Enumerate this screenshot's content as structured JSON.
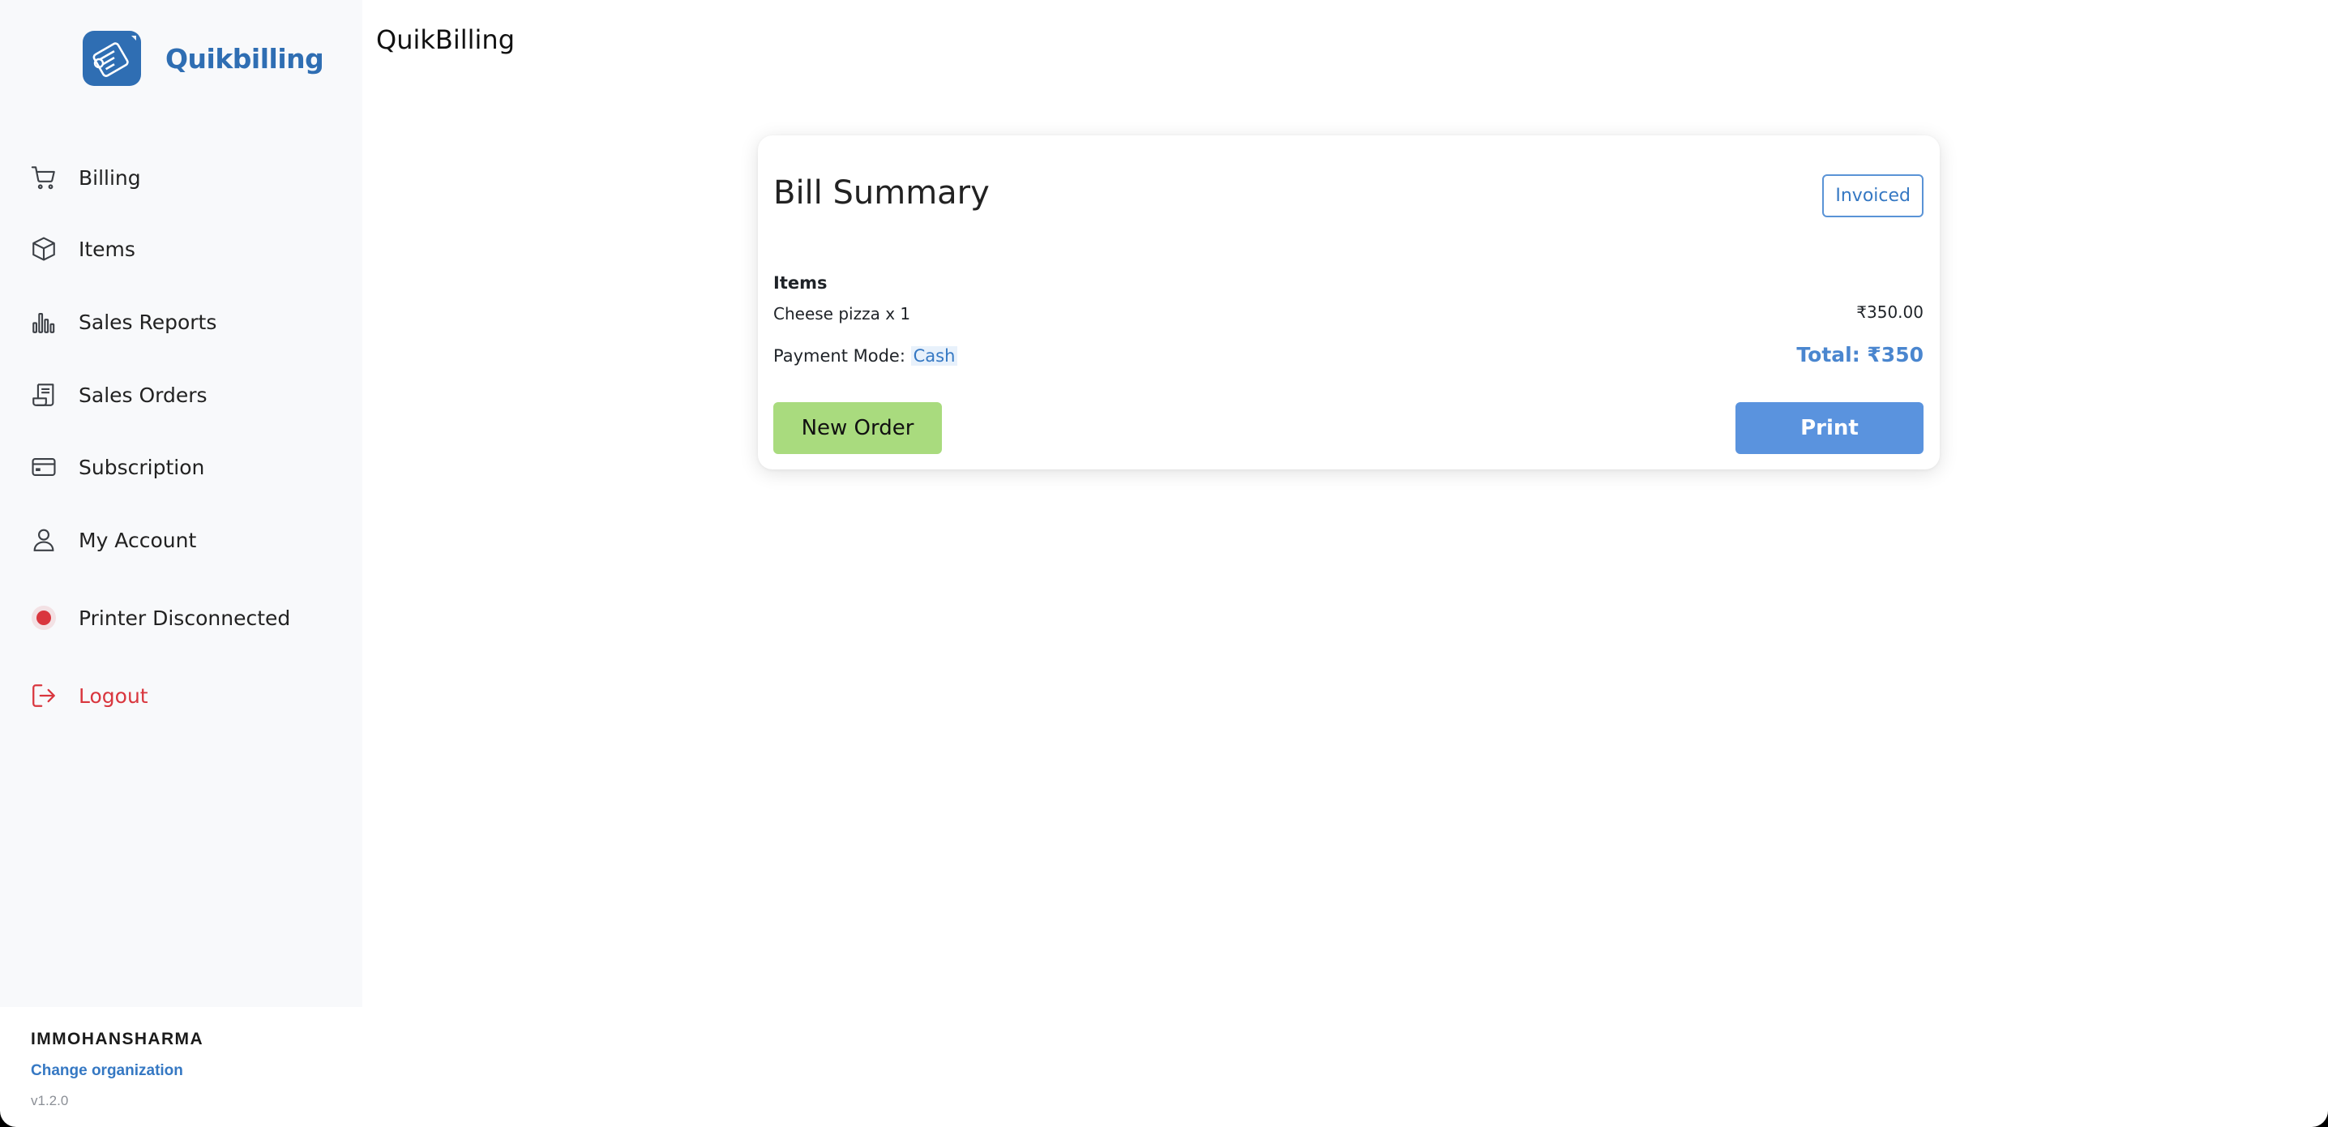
{
  "app": {
    "title": "QuikBilling"
  },
  "logo": {
    "text": "Quikbilling"
  },
  "sidebar": {
    "items": [
      {
        "label": "Billing",
        "icon": "cart-icon"
      },
      {
        "label": "Items",
        "icon": "box-icon"
      },
      {
        "label": "Sales Reports",
        "icon": "bar-chart-icon"
      },
      {
        "label": "Sales Orders",
        "icon": "receipt-icon"
      },
      {
        "label": "Subscription",
        "icon": "credit-card-icon"
      },
      {
        "label": "My Account",
        "icon": "user-icon"
      },
      {
        "label": "Printer Disconnected",
        "icon": "status-dot-icon"
      },
      {
        "label": "Logout",
        "icon": "logout-icon"
      }
    ]
  },
  "organization": {
    "name": "IMMOHANSHARMA",
    "change_label": "Change organization",
    "version": "v1.2.0"
  },
  "bill": {
    "title": "Bill Summary",
    "status": "Invoiced",
    "items_heading": "Items",
    "items": [
      {
        "name": "Cheese pizza x 1",
        "price": "₹350.00"
      }
    ],
    "payment_label": "Payment Mode:",
    "payment_mode": "Cash",
    "total": "Total: ₹350",
    "new_order_label": "New Order",
    "print_label": "Print"
  },
  "colors": {
    "brand": "#2f6eb3",
    "accent": "#5a93de",
    "success": "#a9db7e",
    "danger": "#d9363e"
  }
}
